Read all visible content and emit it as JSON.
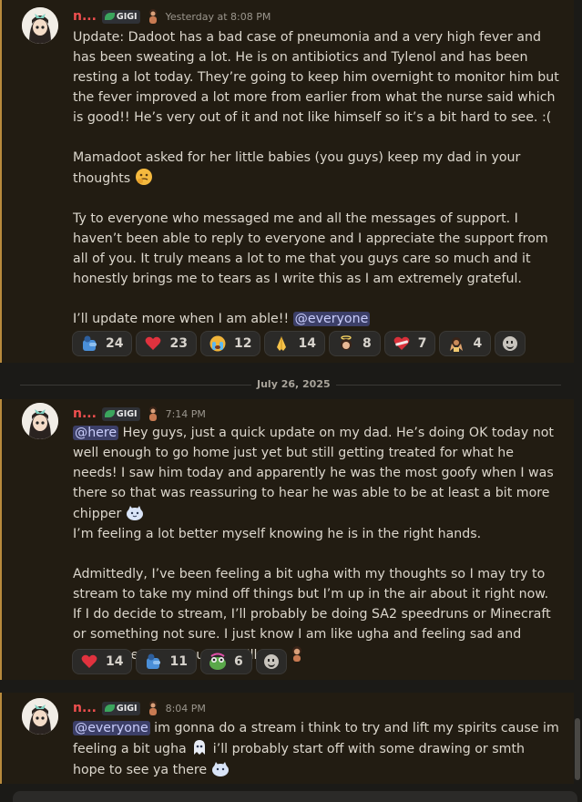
{
  "messages": [
    {
      "username": "n...",
      "tag": "GIGI",
      "time": "Yesterday at 8:08 PM",
      "paragraphs": [
        "Update: Dadoot has a bad case of pneumonia and a very high fever and has been sweating a lot. He is on antibiotics and Tylenol and has been resting a lot today. They’re going to keep him overnight to monitor him but the fever improved a lot more from earlier from what the nurse said which is good!! He’s very out of it and not like himself so it’s a bit hard to see. :(",
        "Mamadoot asked for her little babies (you guys) keep my dad in your thoughts",
        "Ty to everyone who messaged me and all the messages of support. I haven’t been able to reply to everyone and I appreciate the support from all of you. It truly means a lot to me that you guys care so much and it honestly brings me to tears as I write this as I am extremely grateful.",
        "I’ll update more when I am able!!"
      ],
      "mention": "@everyone",
      "reactions": [
        {
          "icon": "hug-icon",
          "color": "#4a8fd8",
          "count": "24"
        },
        {
          "icon": "heart-icon",
          "color": "#e0323e",
          "count": "23"
        },
        {
          "icon": "crying-icon",
          "color": "#f0b43a",
          "count": "12"
        },
        {
          "icon": "pray-icon",
          "color": "#f6c34a",
          "count": "14"
        },
        {
          "icon": "angel-icon",
          "color": "#d9a27a",
          "count": "8"
        },
        {
          "icon": "heart-bandage-icon",
          "color": "#d8303a",
          "count": "7"
        },
        {
          "icon": "praise-icon",
          "color": "#c98a5a",
          "count": "4"
        }
      ]
    },
    {
      "username": "n...",
      "tag": "GIGI",
      "time": "7:14 PM",
      "mention": "@here",
      "paragraphs": [
        " Hey guys, just a quick update on my dad. He’s doing OK today not well enough to go home just yet but still getting treated for what he needs! I saw him today and apparently he was the most goofy when I was there so that was reassuring to hear he was able to be at least a bit more chipper",
        "I’m feeling a lot better myself knowing he is in the right hands.",
        "Admittedly, I’ve been feeling a bit ugha with my thoughts so I may try to stream to take my mind off things but I’m up in the air about it right now. If I do decide to stream, I’ll probably be doing SA2 speedruns or Minecraft or something not sure. I just know I am like ugha and feeling sad and might need a perk up but I’ll see"
      ],
      "reactions": [
        {
          "icon": "heart-icon",
          "color": "#e0323e",
          "count": "14"
        },
        {
          "icon": "hug-icon",
          "color": "#4a8fd8",
          "count": "11"
        },
        {
          "icon": "pepe-icon",
          "color": "#5aa84a",
          "count": "6"
        }
      ]
    },
    {
      "username": "n...",
      "tag": "GIGI",
      "time": "8:04 PM",
      "mention": "@everyone",
      "parts": [
        " im gonna do a stream i think to try and lift my spirits cause im feeling a bit ugha ",
        " i’ll probably start off with some drawing or smth hope to see ya there "
      ]
    }
  ],
  "date_divider": "July 26, 2025"
}
